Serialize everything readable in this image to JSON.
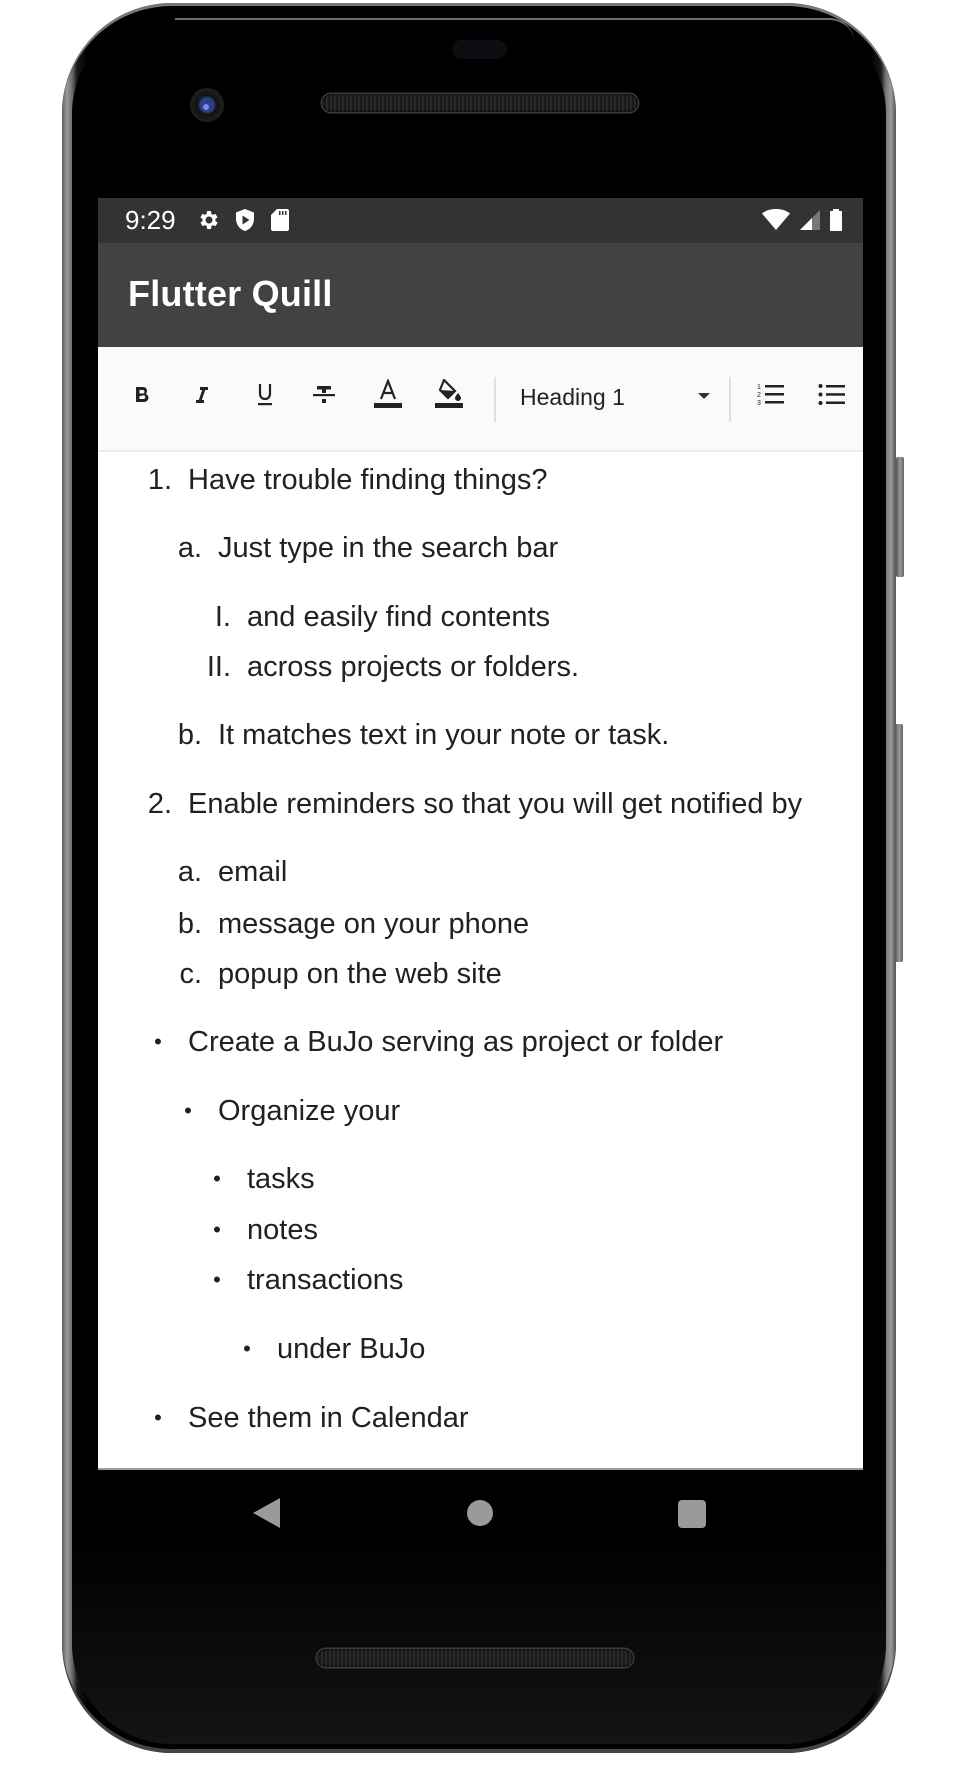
{
  "status_bar": {
    "time": "9:29",
    "left_icons": [
      "gear-icon",
      "shield-play-icon",
      "sd-card-icon"
    ],
    "right_icons": [
      "wifi-icon",
      "cell-signal-icon",
      "battery-icon"
    ]
  },
  "app_bar": {
    "title": "Flutter Quill"
  },
  "toolbar": {
    "buttons": [
      {
        "name": "bold",
        "icon": "bold-icon"
      },
      {
        "name": "italic",
        "icon": "italic-icon"
      },
      {
        "name": "underline",
        "icon": "underline-icon"
      },
      {
        "name": "strikethrough",
        "icon": "strikethrough-icon"
      },
      {
        "name": "text-color",
        "icon": "text-color-icon"
      },
      {
        "name": "background-color",
        "icon": "fill-color-icon"
      },
      {
        "name": "ordered-list",
        "icon": "ordered-list-icon"
      },
      {
        "name": "bullet-list",
        "icon": "bullet-list-icon"
      }
    ],
    "heading_select": {
      "value": "Heading 1"
    }
  },
  "editor": {
    "lines": [
      {
        "type": "ordered",
        "level": 0,
        "marker": "1.",
        "text": "Have trouble finding things?"
      },
      {
        "type": "ordered",
        "level": 1,
        "marker": "a.",
        "text": "Just type in the search bar"
      },
      {
        "type": "ordered",
        "level": 2,
        "marker": "I.",
        "text": "and easily find contents"
      },
      {
        "type": "ordered",
        "level": 2,
        "marker": "II.",
        "text": "across projects or folders."
      },
      {
        "type": "ordered",
        "level": 1,
        "marker": "b.",
        "text": "It matches text in your note or task."
      },
      {
        "type": "ordered",
        "level": 0,
        "marker": "2.",
        "text": "Enable reminders so that you will get notified by"
      },
      {
        "type": "ordered",
        "level": 1,
        "marker": "a.",
        "text": "email"
      },
      {
        "type": "ordered",
        "level": 1,
        "marker": "b.",
        "text": "message on your phone"
      },
      {
        "type": "ordered",
        "level": 1,
        "marker": "c.",
        "text": "popup on the web site"
      },
      {
        "type": "bullet",
        "level": 0,
        "marker": "•",
        "text": "Create a BuJo serving as project or folder"
      },
      {
        "type": "bullet",
        "level": 1,
        "marker": "•",
        "text": "Organize your"
      },
      {
        "type": "bullet",
        "level": 2,
        "marker": "•",
        "text": "tasks"
      },
      {
        "type": "bullet",
        "level": 2,
        "marker": "•",
        "text": "notes"
      },
      {
        "type": "bullet",
        "level": 2,
        "marker": "•",
        "text": "transactions"
      },
      {
        "type": "bullet",
        "level": 3,
        "marker": "•",
        "text": "under BuJo"
      },
      {
        "type": "bullet",
        "level": 0,
        "marker": "•",
        "text": "See them in Calendar"
      }
    ]
  },
  "nav_bar": {
    "buttons": [
      "back",
      "home",
      "recents"
    ]
  }
}
